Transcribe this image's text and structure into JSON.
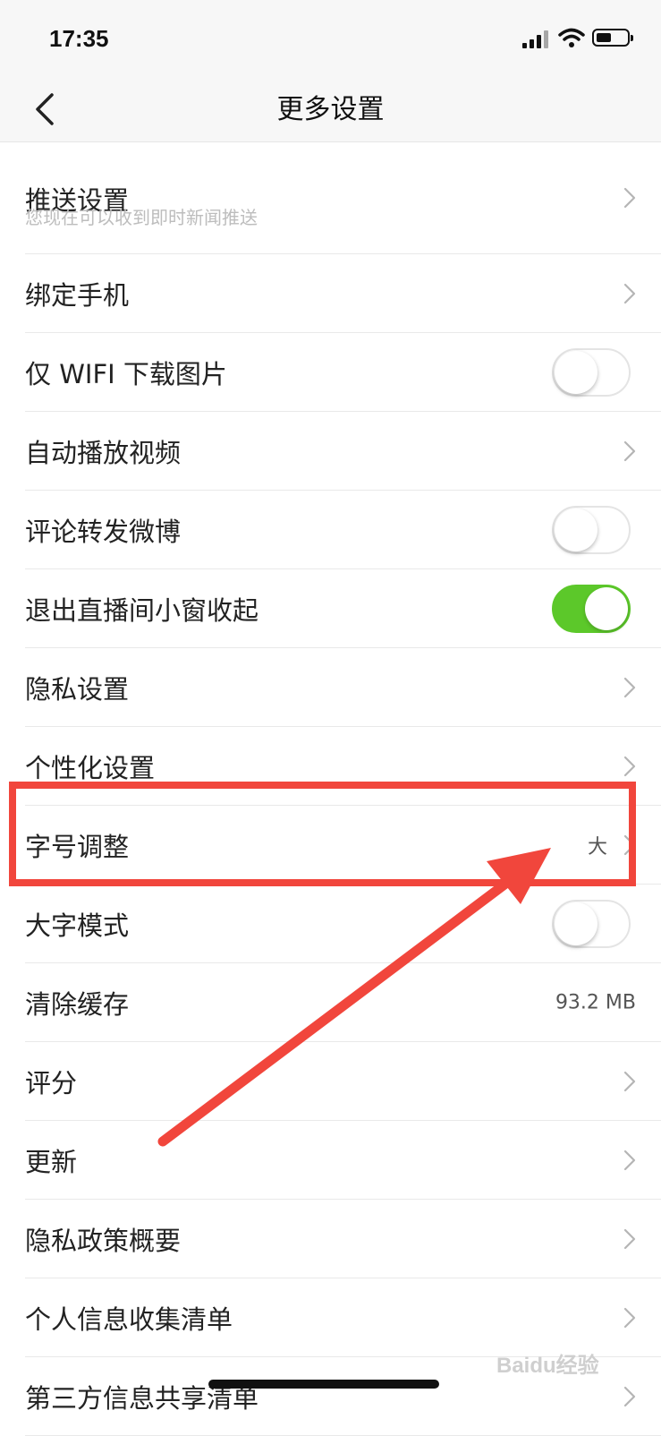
{
  "status_bar": {
    "time": "17:35"
  },
  "nav": {
    "title": "更多设置"
  },
  "settings": [
    {
      "label": "推送设置",
      "subtitle": "您现在可以收到即时新闻推送",
      "control": "chevron"
    },
    {
      "label": "绑定手机",
      "control": "chevron"
    },
    {
      "label": "仅 WIFI 下载图片",
      "control": "toggle",
      "on": false
    },
    {
      "label": "自动播放视频",
      "control": "chevron"
    },
    {
      "label": "评论转发微博",
      "control": "toggle",
      "on": false
    },
    {
      "label": "退出直播间小窗收起",
      "control": "toggle",
      "on": true
    },
    {
      "label": "隐私设置",
      "control": "chevron"
    },
    {
      "label": "个性化设置",
      "control": "chevron"
    },
    {
      "label": "字号调整",
      "value": "大",
      "control": "chevron"
    },
    {
      "label": "大字模式",
      "control": "toggle",
      "on": false
    },
    {
      "label": "清除缓存",
      "value": "93.2 MB",
      "control": "value"
    },
    {
      "label": "评分",
      "control": "chevron"
    },
    {
      "label": "更新",
      "control": "chevron"
    },
    {
      "label": "隐私政策概要",
      "control": "chevron"
    },
    {
      "label": "个人信息收集清单",
      "control": "chevron"
    },
    {
      "label": "第三方信息共享清单",
      "control": "chevron"
    }
  ],
  "watermark": "Baidu经验",
  "colors": {
    "toggle_on": "#5cc82a",
    "annotation": "#f1463c"
  }
}
